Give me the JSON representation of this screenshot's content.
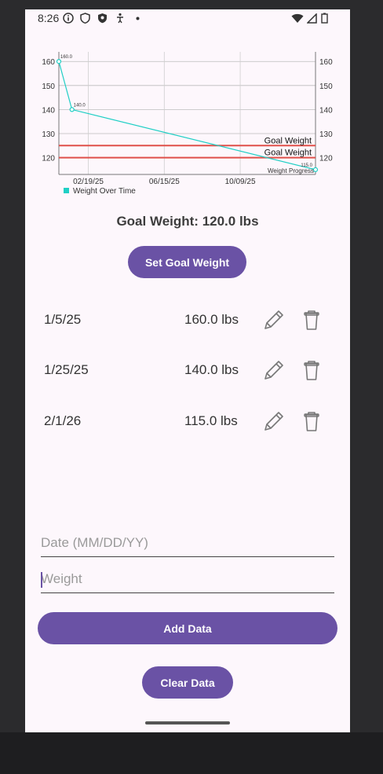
{
  "status_bar": {
    "time": "8:26"
  },
  "chart_data": {
    "type": "line",
    "series": [
      {
        "name": "Weight Over Time",
        "x": [
          "1/5/25",
          "1/25/25",
          "2/1/26"
        ],
        "values": [
          160.0,
          140.0,
          115.0
        ],
        "point_labels": [
          "160.0",
          "140.0",
          "115.0"
        ],
        "color": "#1fcfc5"
      }
    ],
    "goal_lines": [
      {
        "label": "Goal Weight",
        "value": 125,
        "color": "#e0504a"
      },
      {
        "label": "Goal Weight",
        "value": 120,
        "color": "#e0504a"
      }
    ],
    "x_tick_labels": [
      "02/19/25",
      "06/15/25",
      "10/09/25"
    ],
    "y_ticks": [
      120,
      130,
      140,
      150,
      160
    ],
    "ylim": [
      113,
      164
    ],
    "description": "Weight Progress",
    "legend": "bottom-left",
    "grid": true
  },
  "goal": {
    "text": "Goal Weight: 120.0 lbs"
  },
  "buttons": {
    "set_goal": "Set Goal Weight",
    "add_data": "Add Data",
    "clear_data": "Clear Data"
  },
  "entries": [
    {
      "date": "1/5/25",
      "weight": "160.0 lbs"
    },
    {
      "date": "1/25/25",
      "weight": "140.0 lbs"
    },
    {
      "date": "2/1/26",
      "weight": "115.0 lbs"
    }
  ],
  "inputs": {
    "date_placeholder": "Date (MM/DD/YY)",
    "weight_placeholder": "Weight"
  },
  "colors": {
    "accent": "#6a52a5",
    "line": "#1fcfc5",
    "goal": "#e0504a",
    "background": "#fdf7fc"
  }
}
